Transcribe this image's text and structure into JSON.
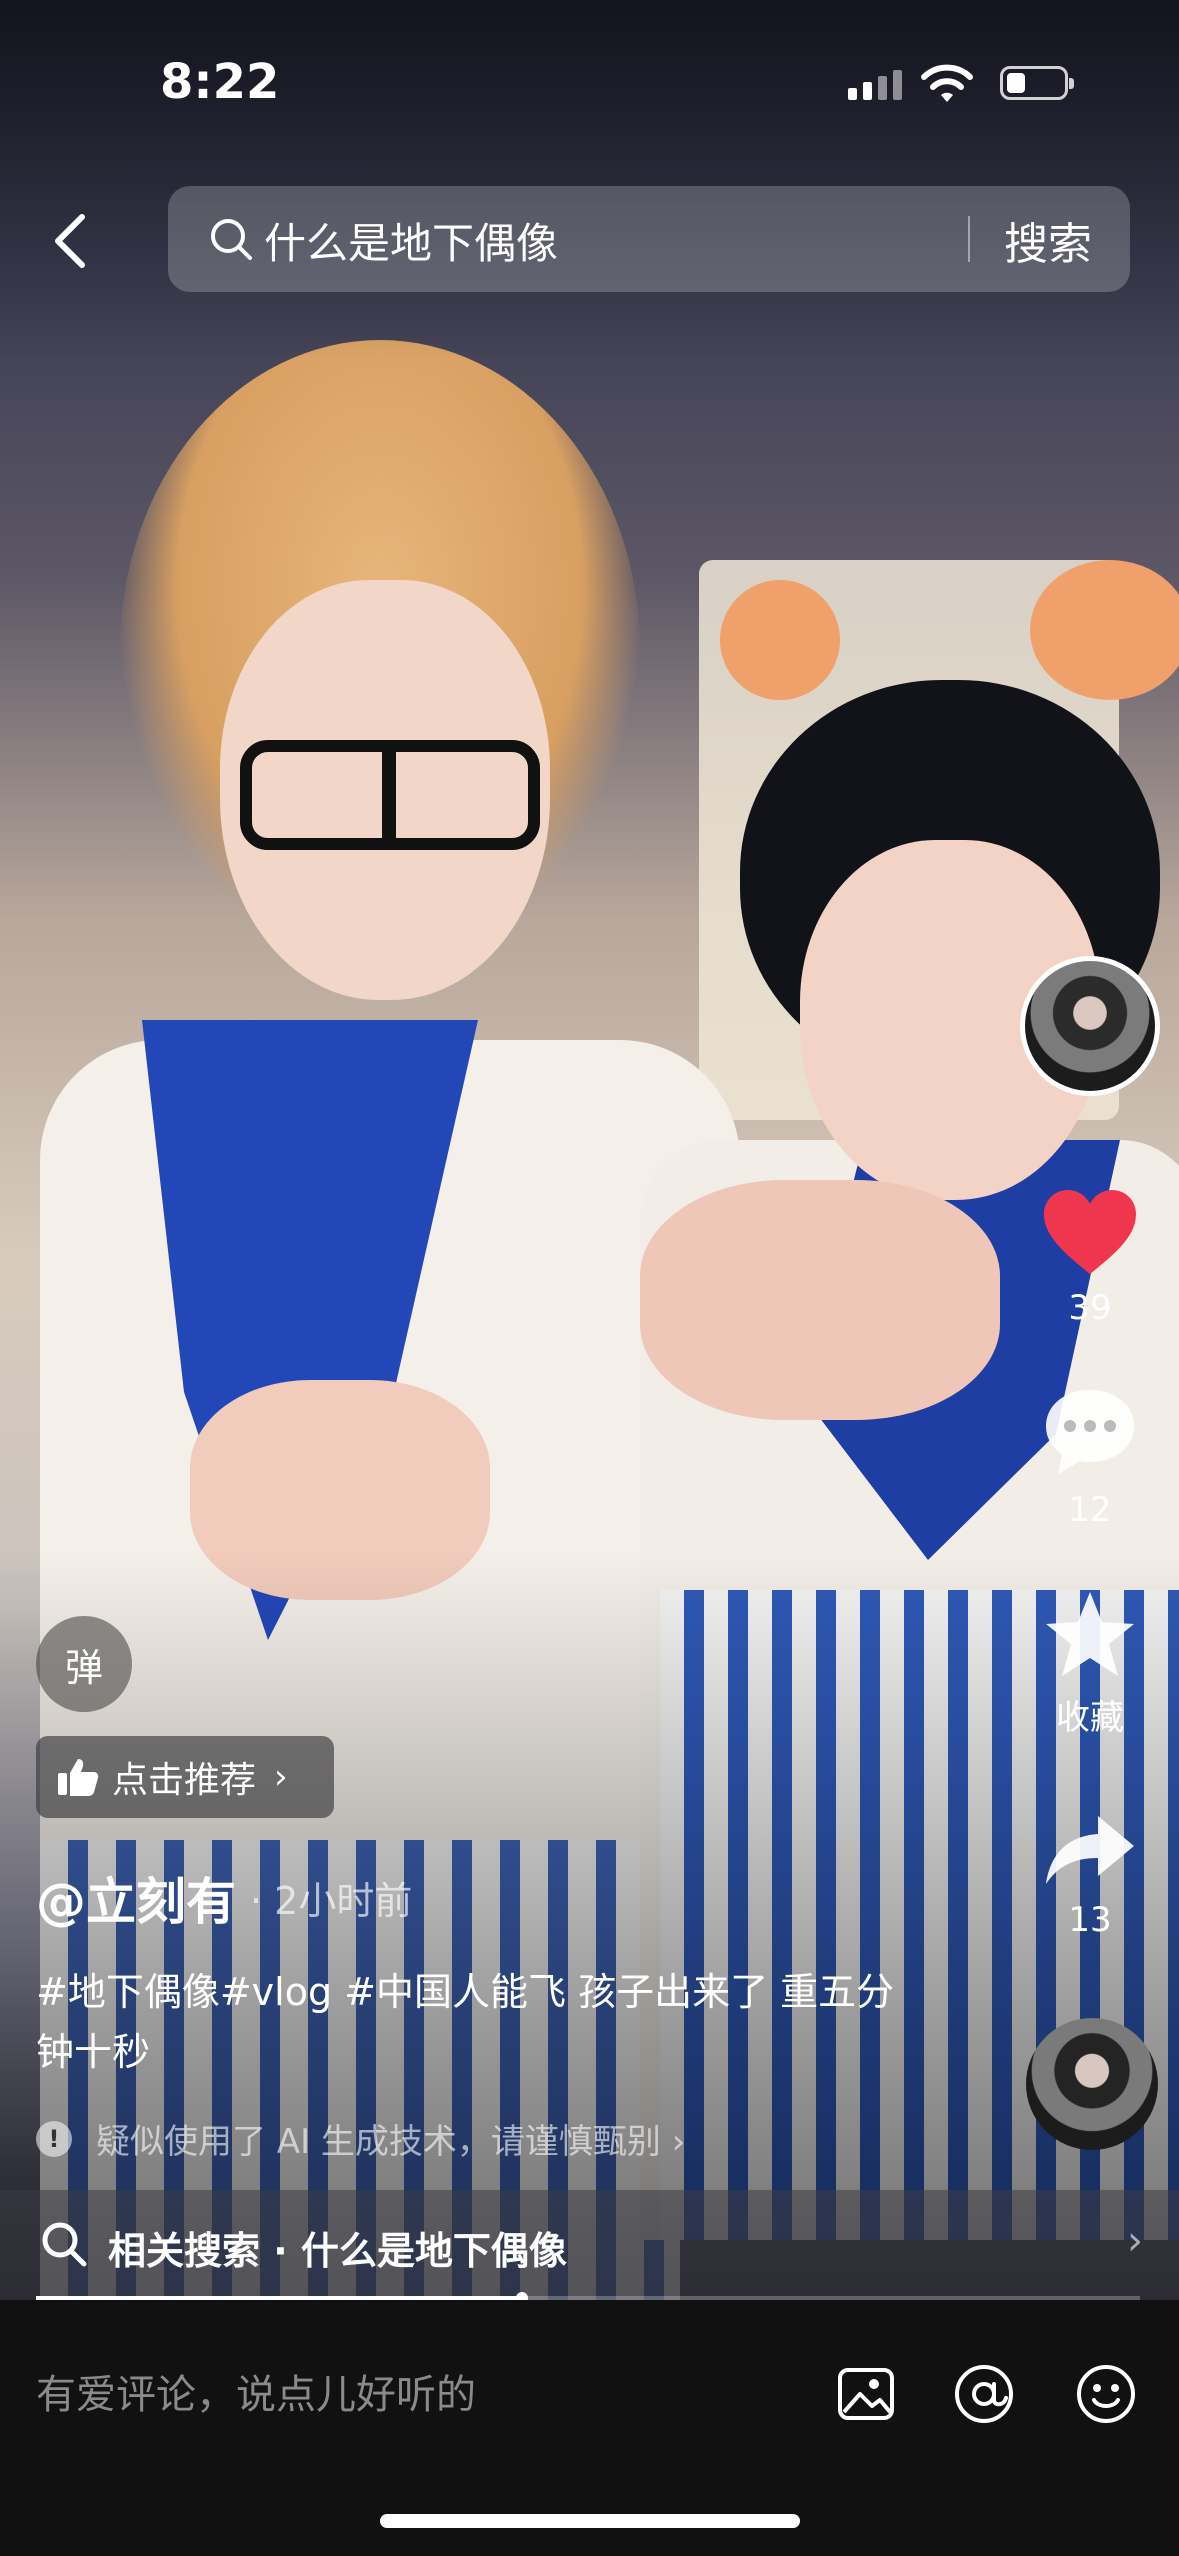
{
  "status_bar": {
    "time": "8:22"
  },
  "search": {
    "query": "什么是地下偶像",
    "button": "搜索"
  },
  "rail": {
    "likes": "39",
    "comments": "12",
    "favorite_label": "收藏",
    "shares": "13"
  },
  "overlay": {
    "danmu_label": "弹",
    "recommend_label": "点击推荐",
    "author": "@立刻有",
    "time_ago": "· 2小时前",
    "caption": "#地下偶像#vlog #中国人能飞 孩子出来了 重五分钟十秒",
    "ai_notice": "疑似使用了 AI 生成技术，请谨慎甄别 ›",
    "related": "相关搜索 · 什么是地下偶像"
  },
  "progress": {
    "fraction": 0.44
  },
  "comment_bar": {
    "placeholder": "有爱评论，说点儿好听的"
  },
  "colors": {
    "like_red": "#f0364f",
    "scarf_blue": "#2447b8"
  },
  "icons": [
    "back-icon",
    "search-icon",
    "heart-icon",
    "comment-icon",
    "star-icon",
    "share-icon",
    "image-icon",
    "at-icon",
    "emoji-icon",
    "thumbs-up-icon",
    "warning-icon"
  ]
}
